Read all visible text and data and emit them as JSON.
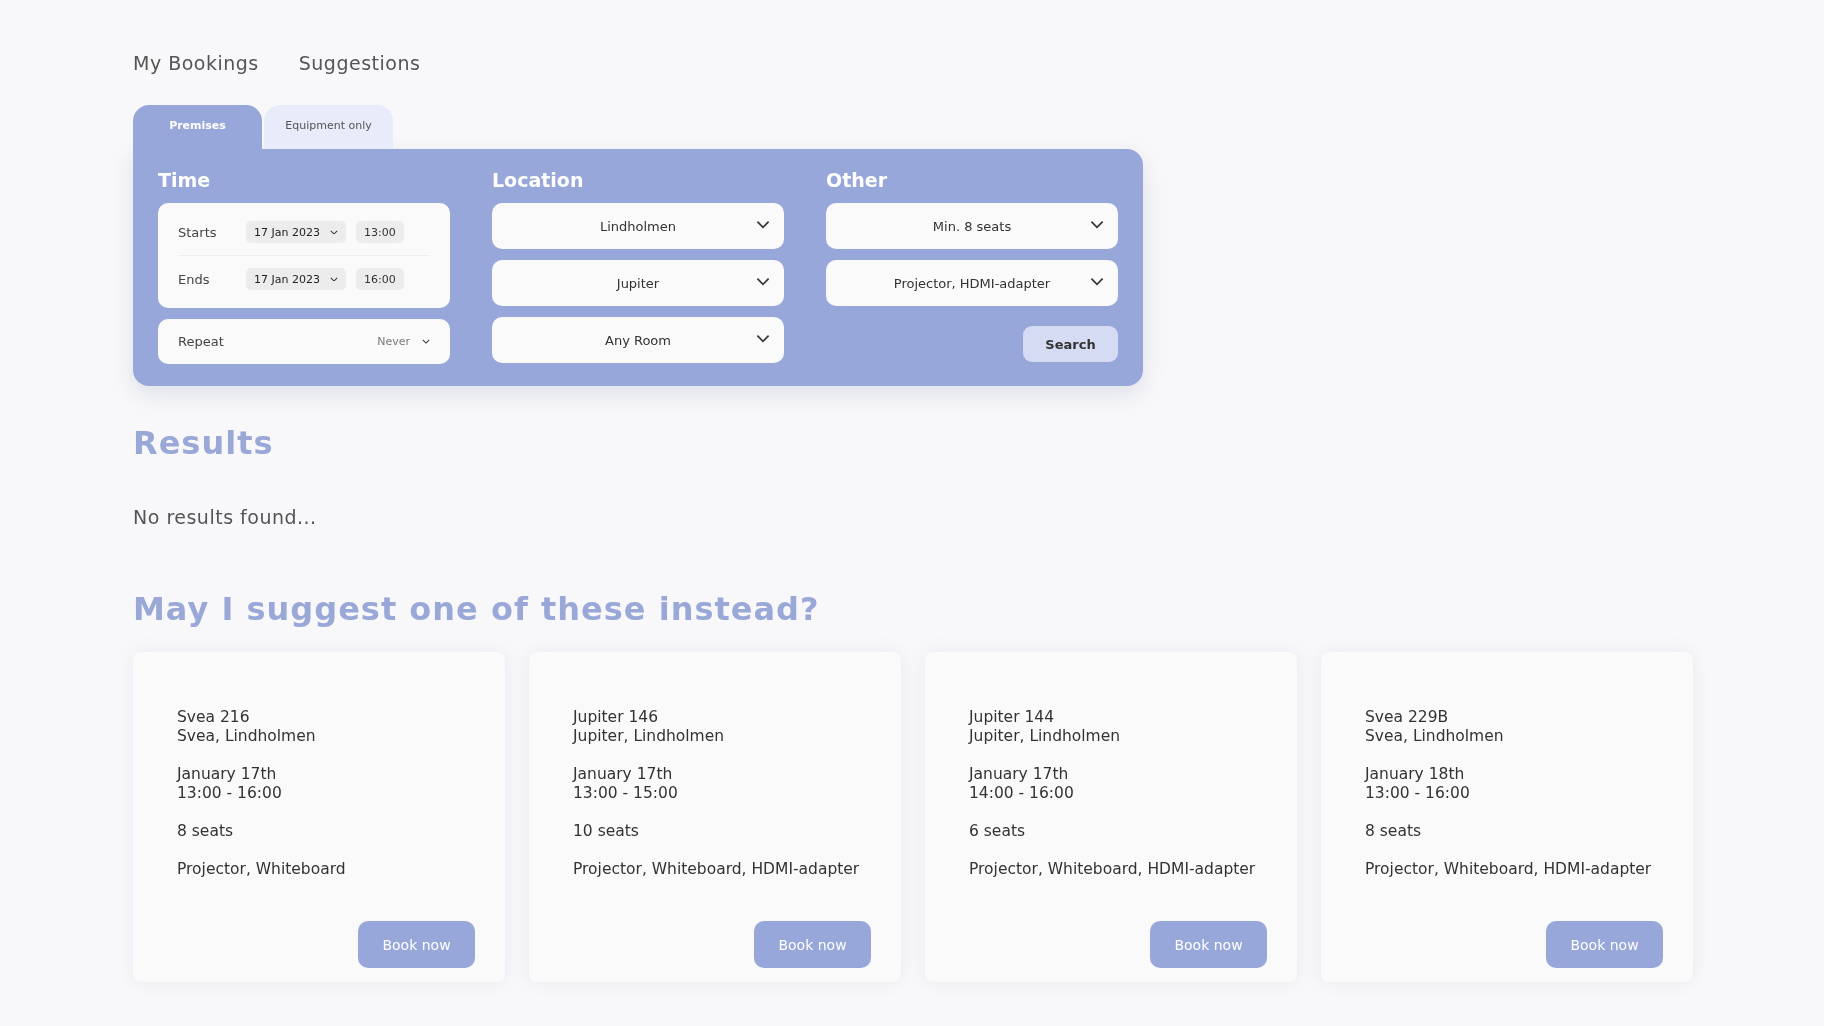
{
  "nav": [
    {
      "label": "My Bookings"
    },
    {
      "label": "Suggestions"
    }
  ],
  "tabs": [
    {
      "label": "Premises",
      "selected": true
    },
    {
      "label": "Equipment only",
      "selected": false
    }
  ],
  "time": {
    "title": "Time",
    "rows": [
      {
        "label": "Starts",
        "date": "17 Jan 2023",
        "time": "13:00"
      },
      {
        "label": "Ends",
        "date": "17 Jan 2023",
        "time": "16:00"
      }
    ],
    "repeat": {
      "label": "Repeat",
      "value": "Never"
    }
  },
  "location": {
    "title": "Location",
    "selects": [
      "Lindholmen",
      "Jupiter",
      "Any Room"
    ]
  },
  "other": {
    "title": "Other",
    "selects": [
      "Min. 8 seats",
      "Projector, HDMI-adapter"
    ],
    "button": "Search"
  },
  "results": {
    "title": "Results",
    "message": "No results found..."
  },
  "suggestions": {
    "title": "May I suggest one of these instead?",
    "cards": [
      {
        "room": "Svea 216",
        "place": "Svea, Lindholmen",
        "date": "January 17th",
        "hours": "13:00 - 16:00",
        "seats": "8 seats",
        "equipment": "Projector, Whiteboard",
        "button": "Book now"
      },
      {
        "room": "Jupiter 146",
        "place": "Jupiter, Lindholmen",
        "date": "January 17th",
        "hours": "13:00 - 15:00",
        "seats": "10 seats",
        "equipment": "Projector, Whiteboard, HDMI-adapter",
        "button": "Book now"
      },
      {
        "room": "Jupiter 144",
        "place": "Jupiter, Lindholmen",
        "date": "January 17th",
        "hours": "14:00 - 16:00",
        "seats": "6 seats",
        "equipment": "Projector, Whiteboard, HDMI-adapter",
        "button": "Book now"
      },
      {
        "room": "Svea 229B",
        "place": "Svea, Lindholmen",
        "date": "January 18th",
        "hours": "13:00 - 16:00",
        "seats": "8 seats",
        "equipment": "Projector, Whiteboard, HDMI-adapter",
        "button": "Book now"
      }
    ]
  }
}
